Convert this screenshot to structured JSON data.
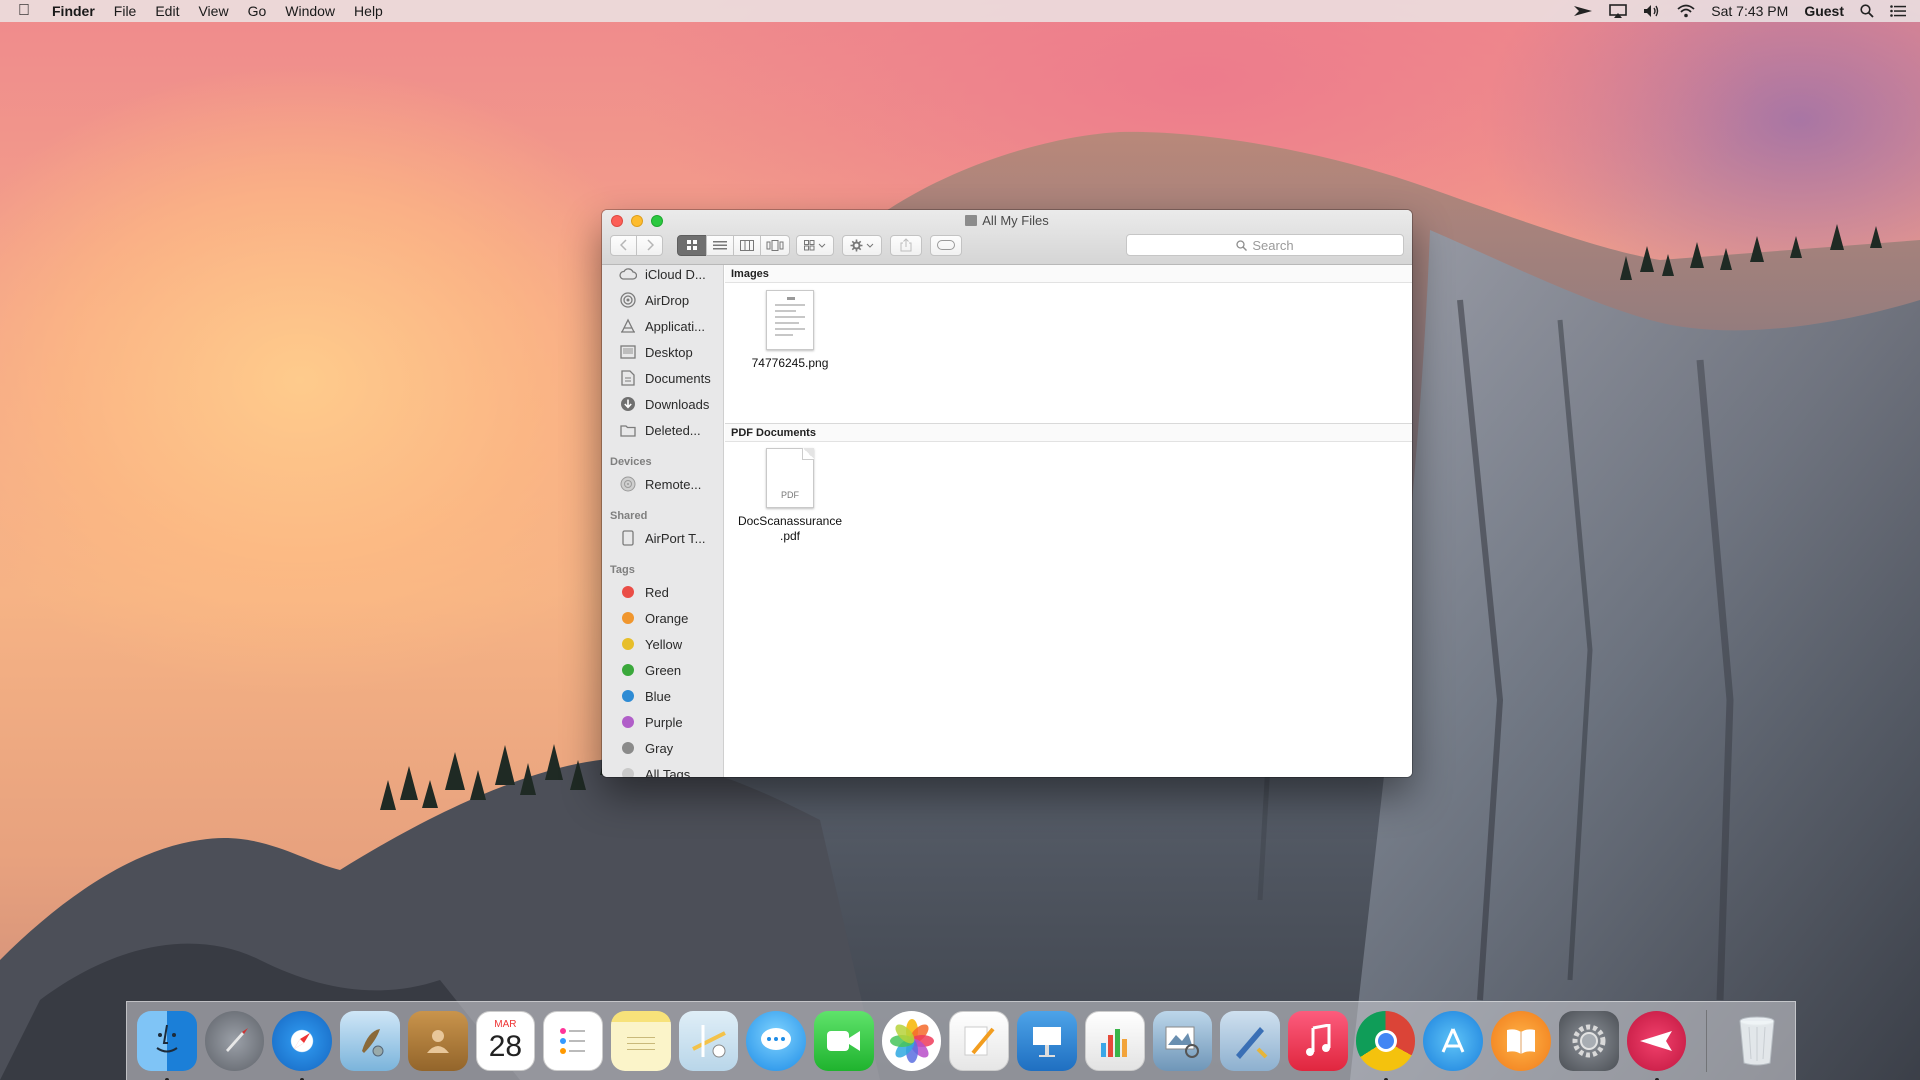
{
  "menubar": {
    "apple": "",
    "app_name": "Finder",
    "menus": [
      "File",
      "Edit",
      "View",
      "Go",
      "Window",
      "Help"
    ],
    "clock": "Sat 7:43 PM",
    "user": "Guest"
  },
  "window": {
    "title": "All My Files",
    "search_placeholder": "Search"
  },
  "sidebar": {
    "favorites": [
      {
        "label": "iCloud D...",
        "icon": "cloud-icon"
      },
      {
        "label": "AirDrop",
        "icon": "airdrop-icon"
      },
      {
        "label": "Applicati...",
        "icon": "applications-icon"
      },
      {
        "label": "Desktop",
        "icon": "desktop-icon"
      },
      {
        "label": "Documents",
        "icon": "documents-icon"
      },
      {
        "label": "Downloads",
        "icon": "downloads-icon"
      },
      {
        "label": "Deleted...",
        "icon": "folder-icon"
      }
    ],
    "devices_header": "Devices",
    "devices": [
      {
        "label": "Remote...",
        "icon": "disc-icon"
      }
    ],
    "shared_header": "Shared",
    "shared": [
      {
        "label": "AirPort T...",
        "icon": "airport-icon"
      }
    ],
    "tags_header": "Tags",
    "tags": [
      {
        "label": "Red",
        "color": "#ea4d46"
      },
      {
        "label": "Orange",
        "color": "#f0962e"
      },
      {
        "label": "Yellow",
        "color": "#e7be2a"
      },
      {
        "label": "Green",
        "color": "#3aa83b"
      },
      {
        "label": "Blue",
        "color": "#2e8bd4"
      },
      {
        "label": "Purple",
        "color": "#b05ec8"
      },
      {
        "label": "Gray",
        "color": "#8a8a8a"
      },
      {
        "label": "All Tags...",
        "color": "#c9c9c9"
      }
    ]
  },
  "content": {
    "images_header": "Images",
    "image_file": "74776245.png",
    "pdf_header": "PDF Documents",
    "pdf_file_line1": "DocScanassurance",
    "pdf_file_line2": ".pdf",
    "pdf_badge": "PDF"
  },
  "dock": {
    "calendar_month": "MAR",
    "calendar_day": "28"
  }
}
